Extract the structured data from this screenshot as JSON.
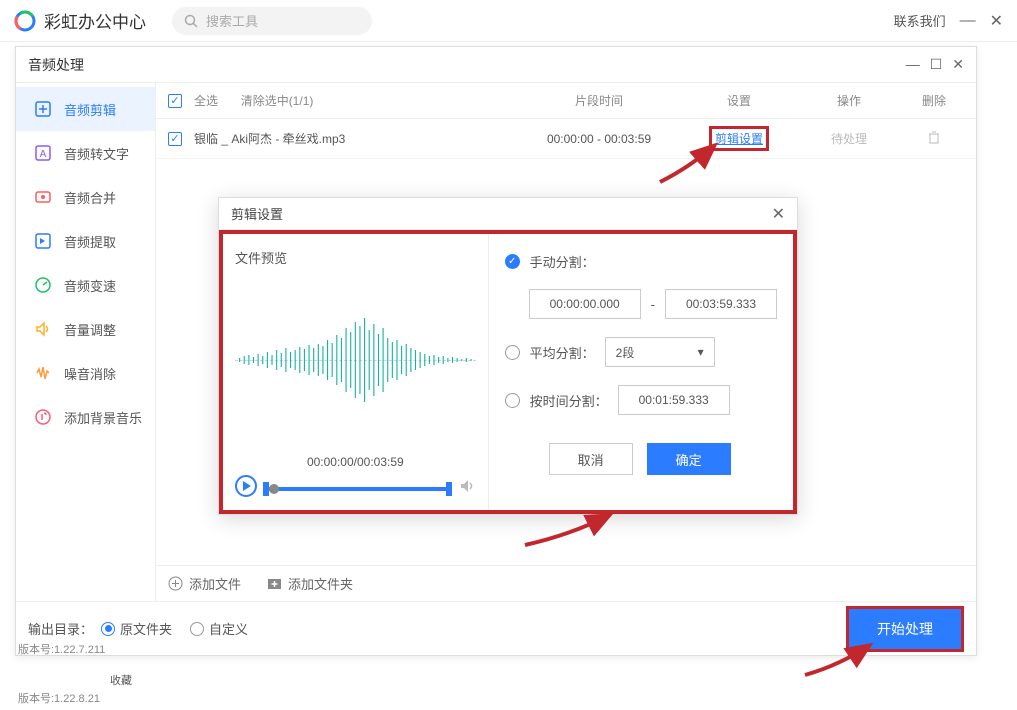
{
  "app": {
    "title": "彩虹办公中心",
    "search_placeholder": "搜索工具",
    "contact": "联系我们"
  },
  "window": {
    "title": "音频处理"
  },
  "sidebar": {
    "items": [
      {
        "label": "音频剪辑",
        "icon": "scissors",
        "color": "#2b7cff"
      },
      {
        "label": "音频转文字",
        "icon": "A-box",
        "color": "#8a5cff"
      },
      {
        "label": "音频合并",
        "icon": "merge",
        "color": "#ff5c5c"
      },
      {
        "label": "音频提取",
        "icon": "extract",
        "color": "#2b7cff"
      },
      {
        "label": "音频变速",
        "icon": "speed",
        "color": "#22c066"
      },
      {
        "label": "音量调整",
        "icon": "volume",
        "color": "#ffb020"
      },
      {
        "label": "噪音消除",
        "icon": "noise",
        "color": "#ff9a3c"
      },
      {
        "label": "添加背景音乐",
        "icon": "bgm",
        "color": "#ff5c7a"
      }
    ]
  },
  "list": {
    "select_all": "全选",
    "clear_sel": "清除选中(1/1)",
    "headers": {
      "time": "片段时间",
      "set": "设置",
      "op": "操作",
      "del": "删除"
    },
    "rows": [
      {
        "name": "银临 _ Aki阿杰 - 牵丝戏.mp3",
        "time": "00:00:00 - 00:03:59",
        "set": "剪辑设置",
        "op": "待处理"
      }
    ]
  },
  "dialog": {
    "title": "剪辑设置",
    "preview_label": "文件预览",
    "time_display": "00:00:00/00:03:59",
    "manual_label": "手动分割：",
    "time_from": "00:00:00.000",
    "time_sep": "-",
    "time_to": "00:03:59.333",
    "avg_label": "平均分割：",
    "avg_value": "2段",
    "bytime_label": "按时间分割：",
    "bytime_value": "00:01:59.333",
    "cancel": "取消",
    "ok": "确定"
  },
  "bottom": {
    "add_file": "添加文件",
    "add_folder": "添加文件夹"
  },
  "footer": {
    "out_label": "输出目录：",
    "original": "原文件夹",
    "custom": "自定义",
    "start": "开始处理"
  },
  "versions": {
    "v1": "版本号:1.22.7.211",
    "collect": "收藏",
    "v2": "版本号:1.22.8.21"
  }
}
